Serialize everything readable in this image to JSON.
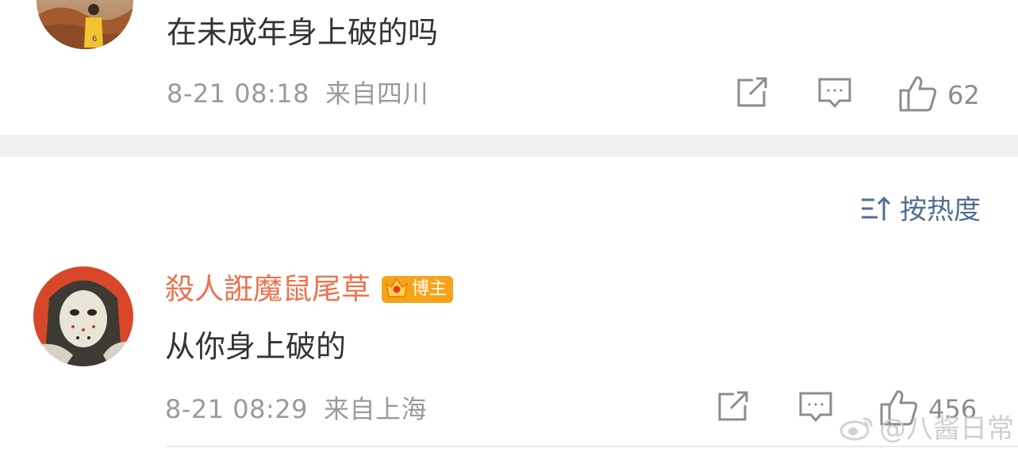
{
  "comments": [
    {
      "text": "在未成年身上破的吗",
      "time": "8-21 08:18",
      "location": "来自四川",
      "likes": "62"
    },
    {
      "username": "殺人誑魔鼠尾草",
      "badge": "博主",
      "text": "从你身上破的",
      "time": "8-21 08:29",
      "location": "来自上海",
      "likes": "456"
    }
  ],
  "sort": {
    "label": "按热度"
  },
  "watermark": {
    "text": "@八酱日常"
  },
  "icons": {
    "share": "share-icon",
    "comment": "comment-icon",
    "like": "thumbs-up-icon",
    "sort": "sort-icon",
    "crown": "crown-icon",
    "weibo": "weibo-logo-icon"
  },
  "colors": {
    "username": "#eb7350",
    "link": "#4f6f90",
    "meta": "#9a9a9a",
    "badge": "#f6a317"
  }
}
